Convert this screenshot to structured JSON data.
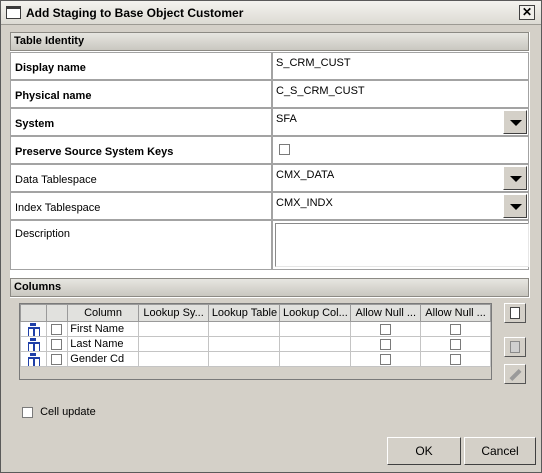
{
  "window": {
    "title": "Add Staging to Base Object Customer",
    "close_label": "✕"
  },
  "table_identity": {
    "header": "Table Identity",
    "display_name": {
      "label": "Display name",
      "value": "S_CRM_CUST"
    },
    "physical_name": {
      "label": "Physical name",
      "value": "C_S_CRM_CUST"
    },
    "system": {
      "label": "System",
      "value": "SFA"
    },
    "preserve_keys": {
      "label": "Preserve Source System Keys",
      "checked": false
    },
    "data_tablespace": {
      "label": "Data Tablespace",
      "value": "CMX_DATA"
    },
    "index_tablespace": {
      "label": "Index Tablespace",
      "value": "CMX_INDX"
    },
    "description": {
      "label": "Description",
      "value": ""
    }
  },
  "columns": {
    "header": "Columns",
    "headers": [
      "",
      "",
      "Column",
      "Lookup Sy...",
      "Lookup Table",
      "Lookup Col...",
      "Allow Null ...",
      "Allow Null ..."
    ],
    "rows": [
      {
        "name": "First Name",
        "lookup_system": "",
        "lookup_table": "",
        "lookup_column": ""
      },
      {
        "name": "Last Name",
        "lookup_system": "",
        "lookup_table": "",
        "lookup_column": ""
      },
      {
        "name": "Gender Cd",
        "lookup_system": "",
        "lookup_table": "",
        "lookup_column": ""
      }
    ],
    "cell_update_label": "Cell update"
  },
  "buttons": {
    "ok": "OK",
    "cancel": "Cancel"
  }
}
